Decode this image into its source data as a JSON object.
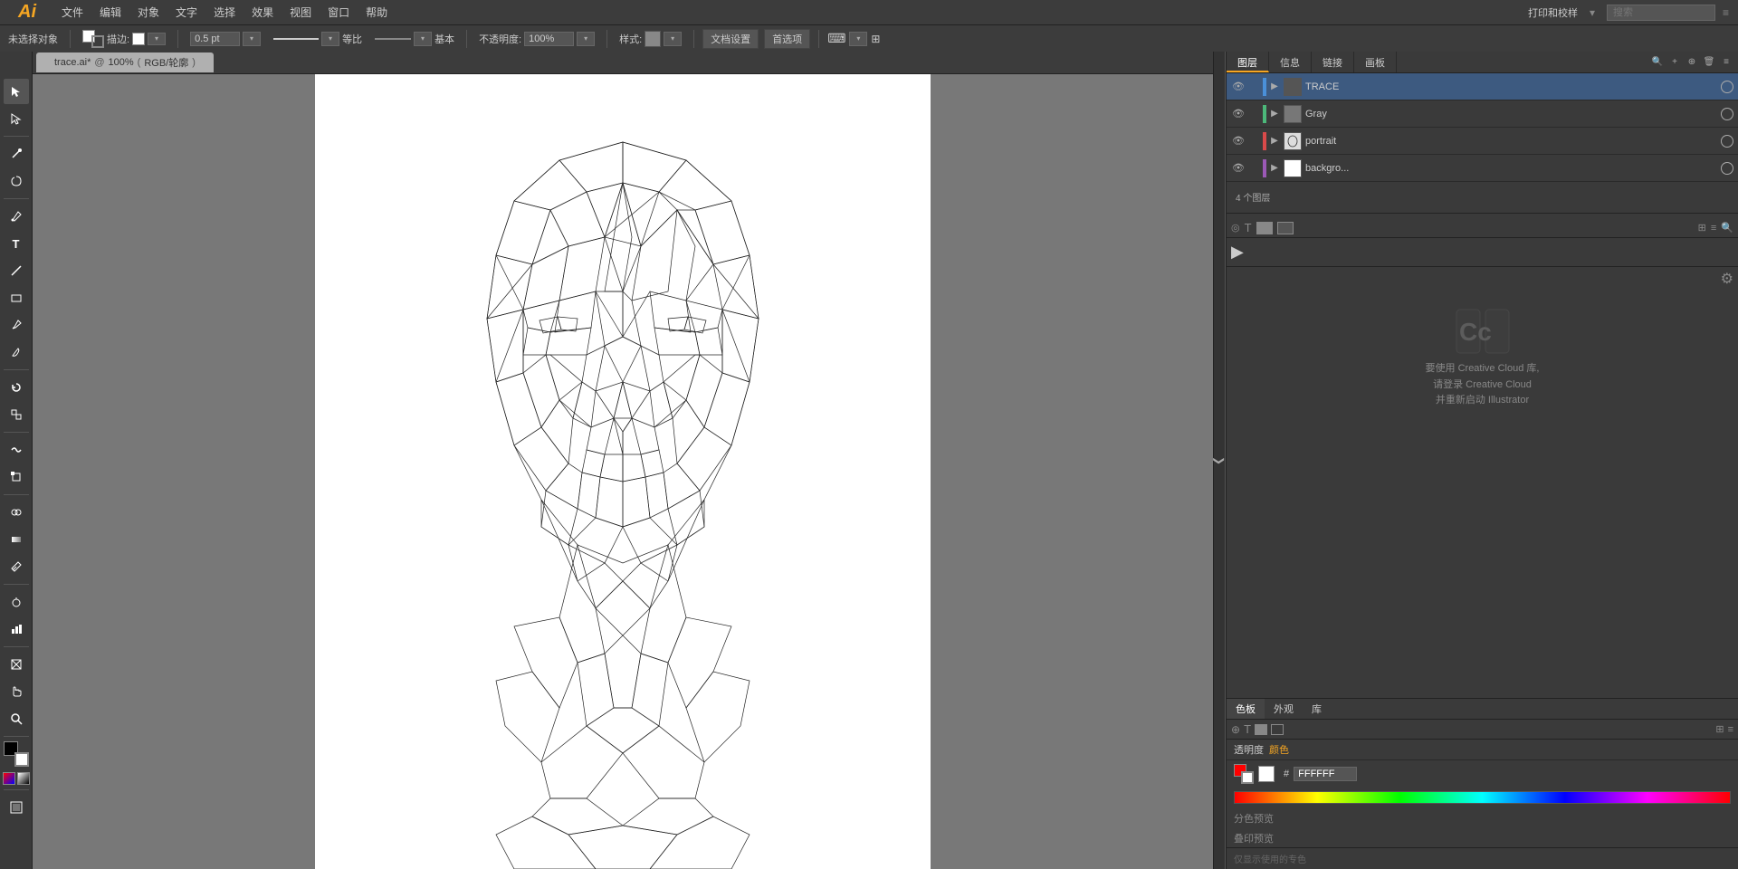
{
  "app": {
    "title": "Ai",
    "name": "Adobe Illustrator"
  },
  "menu": {
    "items": [
      "文件",
      "编辑",
      "对象",
      "文字",
      "选择",
      "效果",
      "视图",
      "窗口",
      "帮助"
    ]
  },
  "toolbar": {
    "selection_label": "未选择对象",
    "stroke_label": "描边:",
    "stroke_value": "0.5 pt",
    "opacity_label": "不透明度:",
    "opacity_value": "100%",
    "style_label": "样式:",
    "doc_settings": "文档设置",
    "preferences": "首选项",
    "equal_label": "等比",
    "basic_label": "基本",
    "stroke_line": "—"
  },
  "tab": {
    "filename": "trace.ai*",
    "zoom": "100%",
    "color_mode": "RGB/轮廓"
  },
  "layers_panel": {
    "title": "图层",
    "tabs": [
      "图层",
      "信息",
      "链接",
      "画板"
    ],
    "count_label": "4 个图层",
    "layers": [
      {
        "name": "TRACE",
        "color": "blue",
        "visible": true,
        "locked": false,
        "has_thumb": false
      },
      {
        "name": "Gray",
        "color": "green",
        "visible": true,
        "locked": false,
        "has_thumb": false
      },
      {
        "name": "portrait",
        "color": "red",
        "visible": true,
        "locked": false,
        "has_thumb": true
      },
      {
        "name": "backgro...",
        "color": "purple",
        "visible": true,
        "locked": false,
        "has_thumb": true
      }
    ],
    "panel_buttons": [
      "新建图层",
      "移动到新图层",
      "删除图层"
    ]
  },
  "color_panel": {
    "tabs": [
      "色板",
      "外观",
      "库"
    ],
    "transparency_label": "透明度",
    "color_label": "颜色",
    "hex_value": "FFFFFF",
    "separator_label": "分色预览",
    "print_preview": "叠印预览"
  },
  "cc_panel": {
    "line1": "要使用 Creative Cloud 库,",
    "line2": "请登录 Creative Cloud",
    "line3": "并重新启动 Illustrator"
  },
  "bottom_label": "仅显示使用的专色",
  "window": {
    "close": "×",
    "minimize": "−",
    "maximize": "+"
  }
}
